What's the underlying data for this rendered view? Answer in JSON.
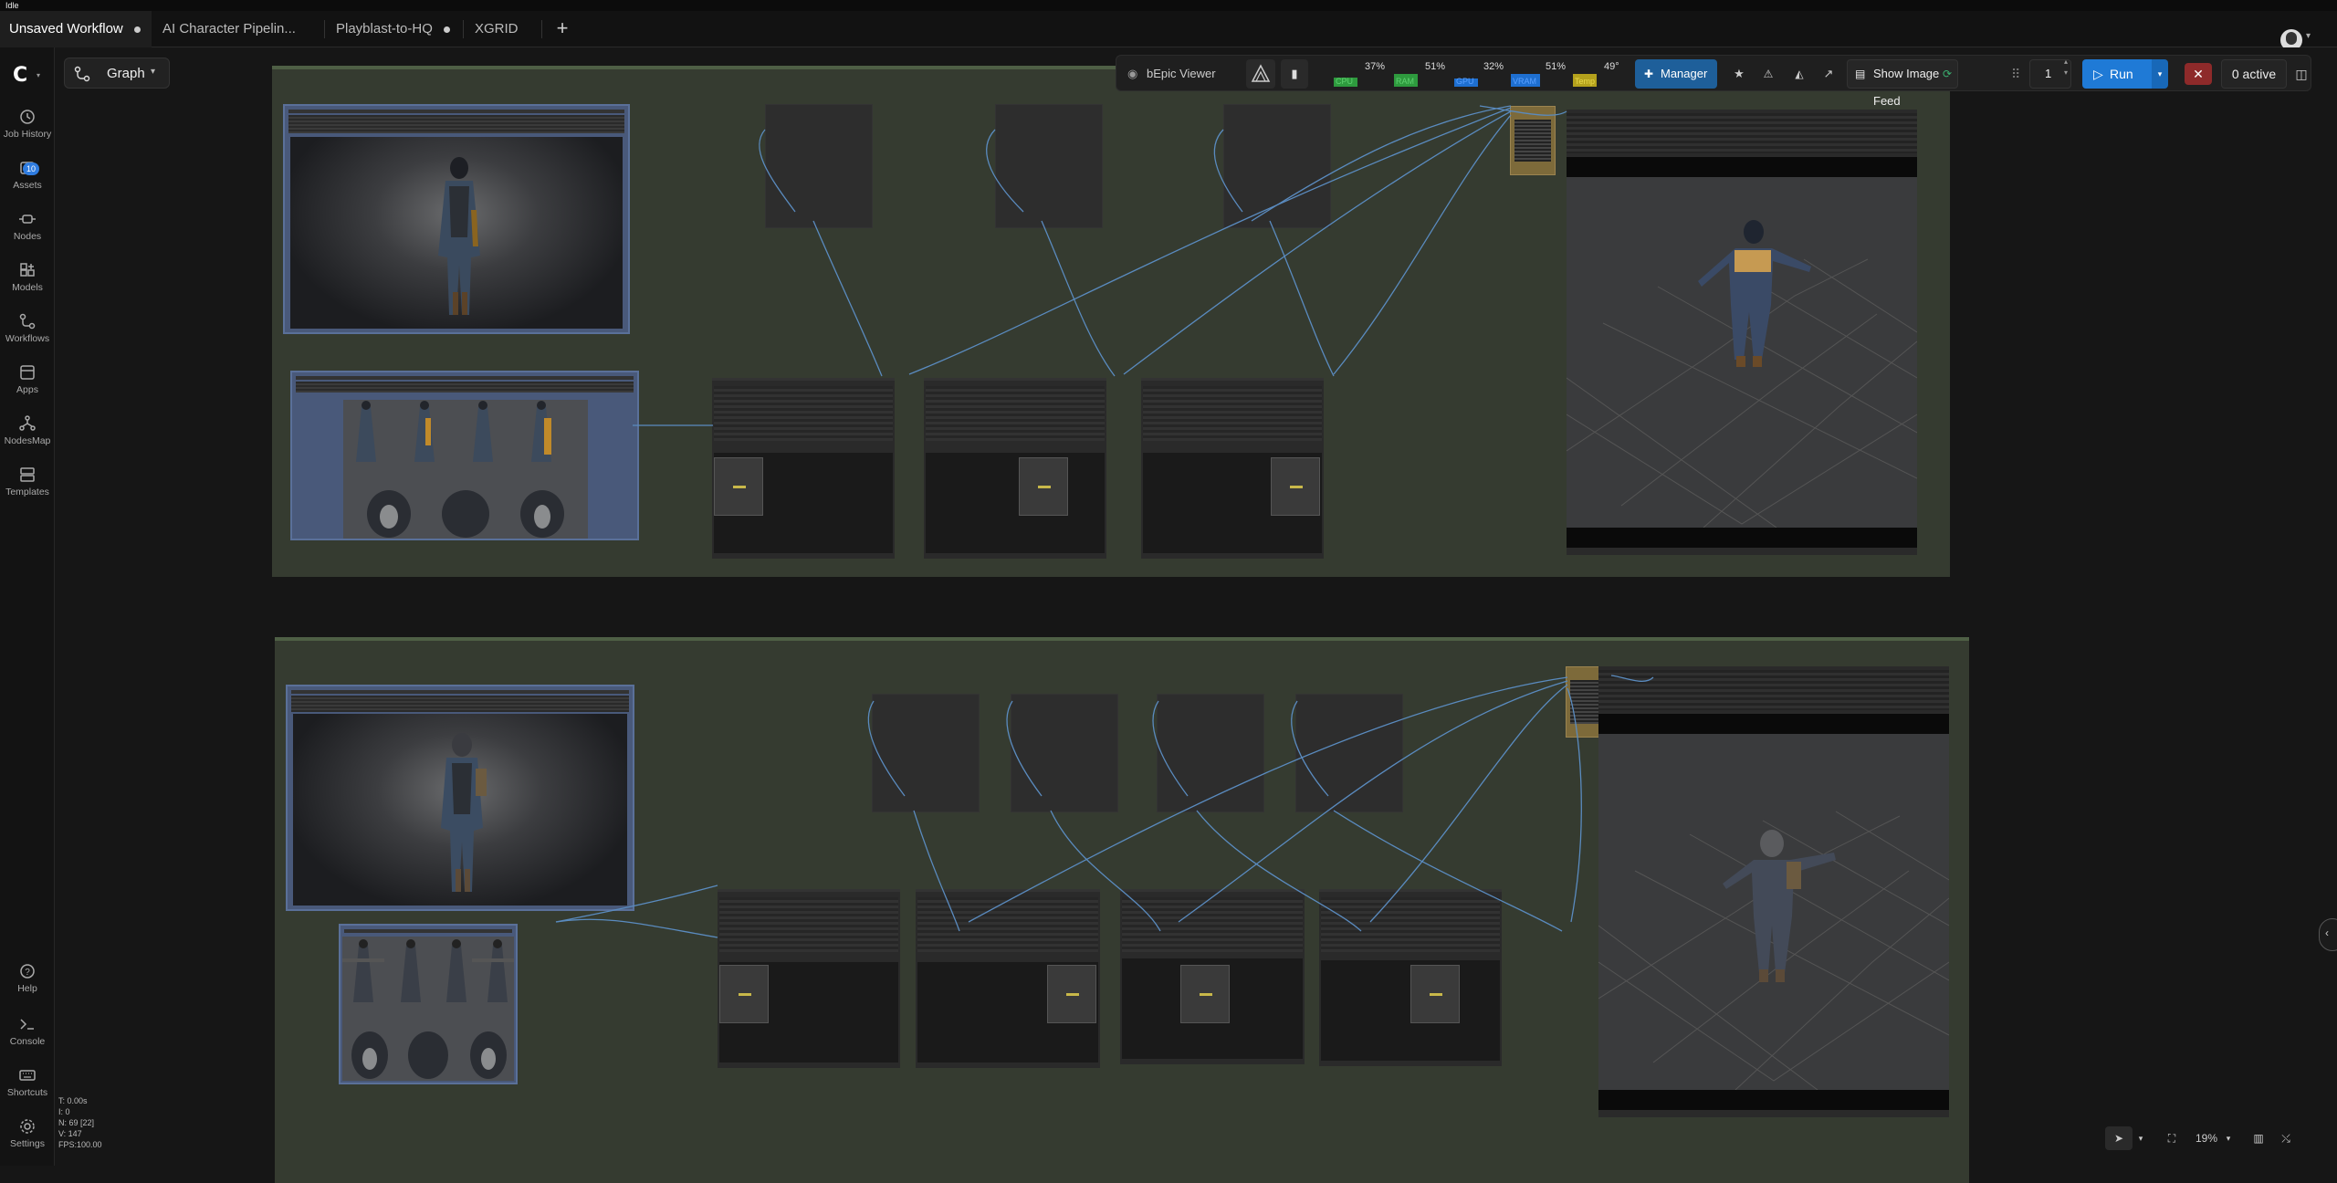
{
  "status": {
    "text": "Idle"
  },
  "tabs": [
    {
      "label": "Unsaved Workflow",
      "active": true,
      "modified": true
    },
    {
      "label": "AI Character Pipelin...",
      "active": false,
      "modified": false
    },
    {
      "label": "Playblast-to-HQ",
      "active": false,
      "modified": true
    },
    {
      "label": "XGRID",
      "active": false,
      "modified": false
    }
  ],
  "sidebar": {
    "items": [
      {
        "label": "Job History",
        "icon": "history-icon"
      },
      {
        "label": "Assets",
        "icon": "assets-icon",
        "badge": "10"
      },
      {
        "label": "Nodes",
        "icon": "nodes-icon"
      },
      {
        "label": "Models",
        "icon": "models-icon"
      },
      {
        "label": "Workflows",
        "icon": "workflows-icon"
      },
      {
        "label": "Apps",
        "icon": "apps-icon"
      },
      {
        "label": "NodesMap",
        "icon": "nodesmap-icon"
      },
      {
        "label": "Templates",
        "icon": "templates-icon"
      }
    ],
    "bottom": [
      {
        "label": "Help",
        "icon": "help-icon"
      },
      {
        "label": "Console",
        "icon": "console-icon"
      },
      {
        "label": "Shortcuts",
        "icon": "keyboard-icon"
      },
      {
        "label": "Settings",
        "icon": "gear-icon"
      }
    ]
  },
  "graph_menu": {
    "label": "Graph"
  },
  "toolbar": {
    "viewer_label": "bEpic Viewer",
    "meters": [
      {
        "label": "CPU",
        "value": "37%",
        "percent": 37,
        "color": "#2e9a3e"
      },
      {
        "label": "RAM",
        "value": "51%",
        "percent": 51,
        "color": "#2e9a3e"
      },
      {
        "label": "GPU",
        "value": "32%",
        "percent": 32,
        "color": "#1e6fd0"
      },
      {
        "label": "VRAM",
        "value": "51%",
        "percent": 51,
        "color": "#1e6fd0"
      },
      {
        "label": "Temp",
        "value": "49°",
        "percent": 49,
        "color": "#b4a11c"
      }
    ],
    "manager_label": "Manager",
    "image_feed_label": "Show Image Feed",
    "queue_count": "1",
    "run_label": "Run",
    "active_label": "0 active"
  },
  "stats": {
    "lines": [
      "T: 0.00s",
      "I: 0",
      "N: 69 [22]",
      "V: 147",
      "FPS:100.00"
    ]
  },
  "zoom": {
    "value": "19%"
  },
  "colors": {
    "accent": "#1f7ad6",
    "manager": "#1e5f9a",
    "group_bg": "#353b30",
    "image_node": "#49597a",
    "cancel": "#8e2a2a"
  }
}
